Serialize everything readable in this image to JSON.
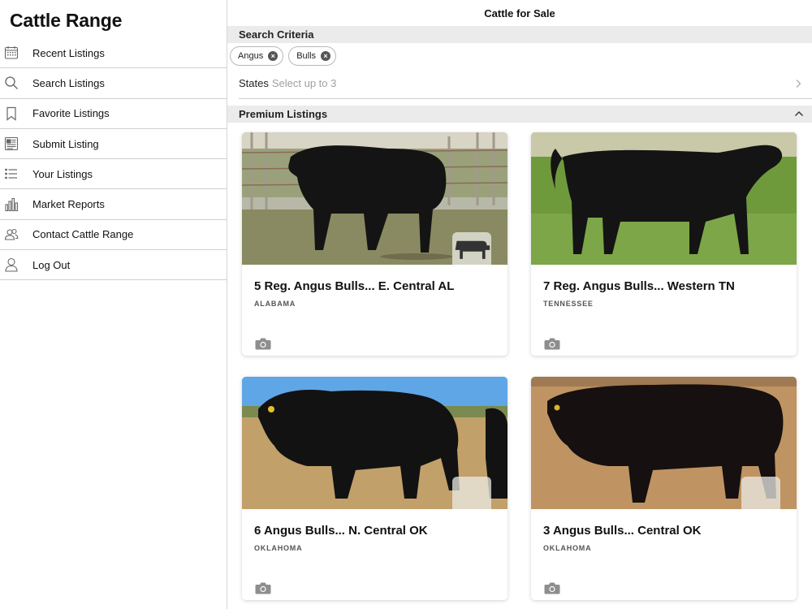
{
  "app": {
    "title": "Cattle Range"
  },
  "sidebar": {
    "items": [
      {
        "label": "Recent Listings",
        "icon": "calendar-icon"
      },
      {
        "label": "Search Listings",
        "icon": "search-icon"
      },
      {
        "label": "Favorite Listings",
        "icon": "bookmark-icon"
      },
      {
        "label": "Submit Listing",
        "icon": "newspaper-icon"
      },
      {
        "label": "Your Listings",
        "icon": "list-icon"
      },
      {
        "label": "Market Reports",
        "icon": "bar-chart-icon"
      },
      {
        "label": "Contact Cattle Range",
        "icon": "people-icon"
      },
      {
        "label": "Log Out",
        "icon": "person-icon"
      }
    ]
  },
  "main": {
    "title": "Cattle for Sale",
    "search_criteria": {
      "header": "Search Criteria",
      "chips": [
        {
          "label": "Angus"
        },
        {
          "label": "Bulls"
        }
      ],
      "states_label": "States",
      "states_placeholder": "Select up to 3"
    },
    "premium": {
      "header": "Premium Listings",
      "listings": [
        {
          "title": "5 Reg. Angus Bulls... E. Central AL",
          "state": "ALABAMA"
        },
        {
          "title": "7 Reg. Angus Bulls... Western TN",
          "state": "TENNESSEE"
        },
        {
          "title": "6 Angus Bulls... N. Central OK",
          "state": "OKLAHOMA"
        },
        {
          "title": "3 Angus Bulls... Central OK",
          "state": "OKLAHOMA"
        }
      ]
    }
  },
  "colors": {
    "section_bg": "#ebebeb",
    "divider": "#d0d0d0",
    "placeholder": "#a0a0a0"
  }
}
